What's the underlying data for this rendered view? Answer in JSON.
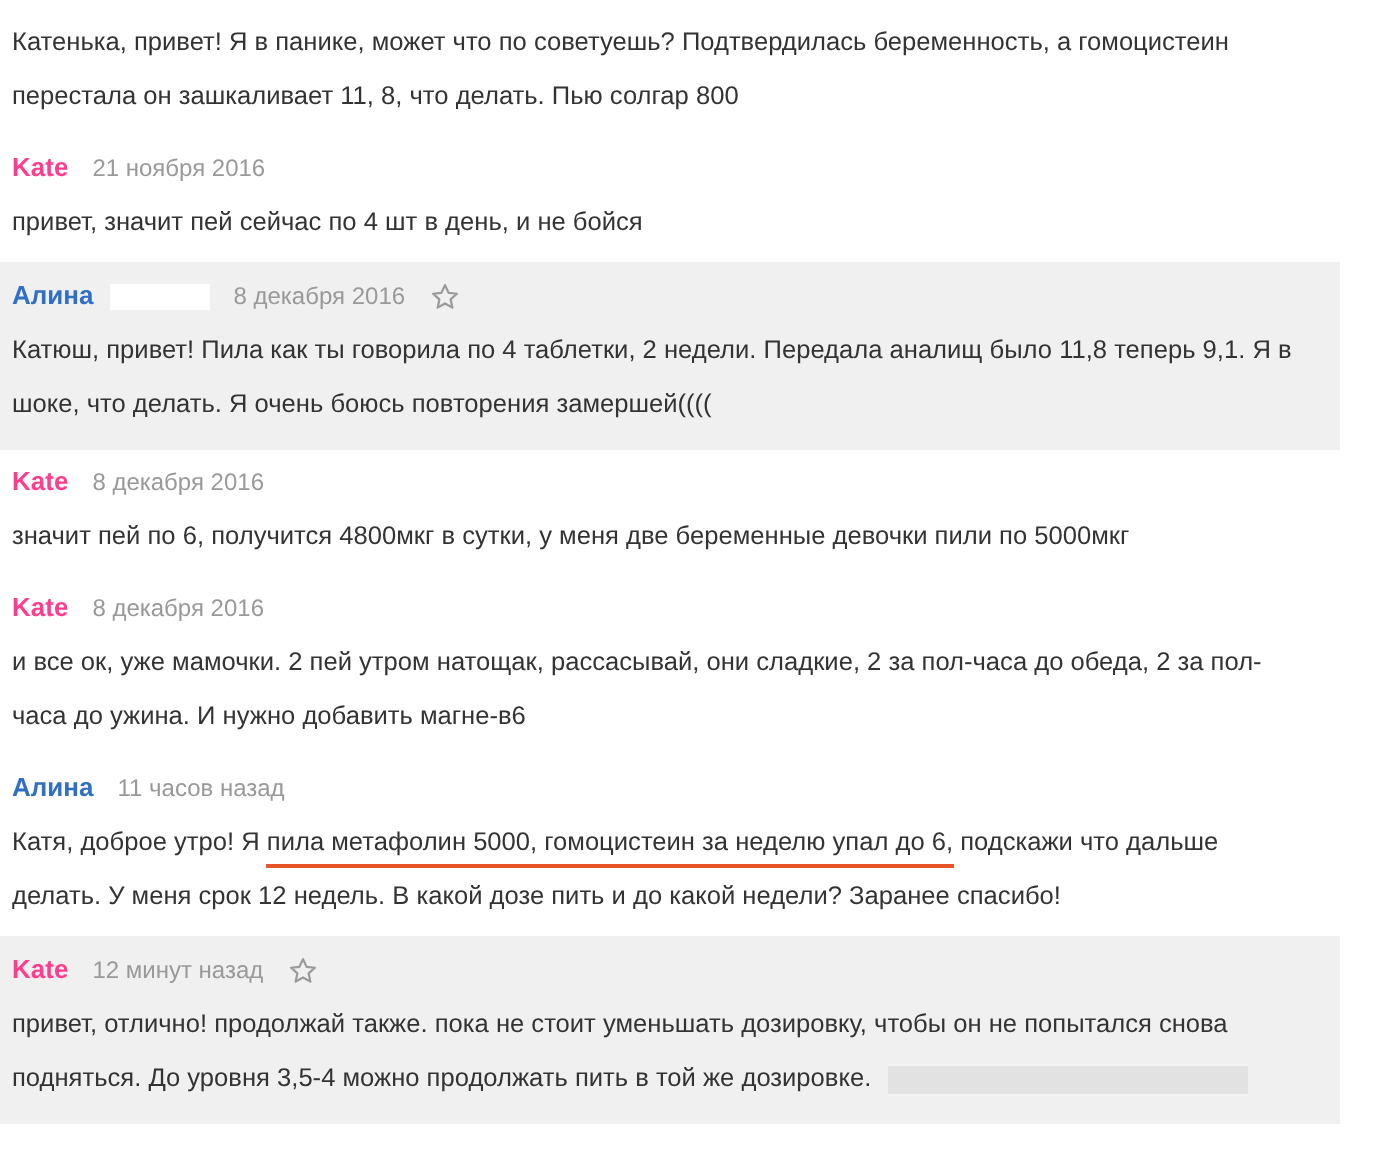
{
  "comments": [
    {
      "highlighted": false,
      "segments": [
        {
          "text": "Катенька, привет! Я в панике, может что по советуешь? Подтвердилась беременность, а гомоцистеин перестала он зашкаливает 11, 8, что делать. Пью солгар 800",
          "underlined": false
        }
      ],
      "trailing_redacted": false
    },
    {
      "author": "Kate",
      "color": "#ff3c8e",
      "date": "21 ноября 2016",
      "star": false,
      "redacted": false,
      "highlighted": false,
      "segments": [
        {
          "text": "привет, значит пей сейчас по 4 шт в день, и не бойся",
          "underlined": false
        }
      ],
      "trailing_redacted": false
    },
    {
      "author": "Алина",
      "color": "#2f6fc6",
      "date": "8 декабря 2016",
      "star": true,
      "redacted": true,
      "highlighted": true,
      "segments": [
        {
          "text": "Катюш, привет! Пила как ты говорила по 4 таблетки, 2 недели. Передала аналищ было 11,8 теперь 9,1. Я в шоке, что делать. Я очень боюсь повторения замершей((((",
          "underlined": false
        }
      ],
      "trailing_redacted": false
    },
    {
      "author": "Kate",
      "color": "#ff3c8e",
      "date": "8 декабря 2016",
      "star": false,
      "redacted": false,
      "highlighted": false,
      "segments": [
        {
          "text": "значит пей по 6, получится 4800мкг в сутки, у меня две беременные девочки пили по 5000мкг",
          "underlined": false
        }
      ],
      "trailing_redacted": false
    },
    {
      "author": "Kate",
      "color": "#ff3c8e",
      "date": "8 декабря 2016",
      "star": false,
      "redacted": false,
      "highlighted": false,
      "segments": [
        {
          "text": "и все ок, уже мамочки. 2 пей утром натощак, рассасывай, они сладкие, 2 за пол-часа до обеда, 2 за пол-часа до ужина. И нужно добавить магне-в6",
          "underlined": false
        }
      ],
      "trailing_redacted": false
    },
    {
      "author": "Алина",
      "color": "#2f6fc6",
      "date": "11 часов назад",
      "star": false,
      "redacted": false,
      "highlighted": false,
      "segments": [
        {
          "text": "Катя, доброе утро! Я ",
          "underlined": false
        },
        {
          "text": "пила метафолин 5000, гомоцистеин за неделю упал до 6,",
          "underlined": true
        },
        {
          "text": " подскажи что дальше делать. У меня срок 12 недель. В какой дозе пить и до какой недели? Заранее спасибо!",
          "underlined": false
        }
      ],
      "trailing_redacted": false
    },
    {
      "author": "Kate",
      "color": "#ff3c8e",
      "date": "12 минут назад",
      "star": true,
      "redacted": false,
      "highlighted": true,
      "segments": [
        {
          "text": "привет, отлично! продолжай также. пока не стоит уменьшать дозировку, чтобы он не попытался снова подняться. До уровня 3,5-4 можно продолжать пить в той же дозировке.",
          "underlined": false
        }
      ],
      "trailing_redacted": true
    }
  ]
}
